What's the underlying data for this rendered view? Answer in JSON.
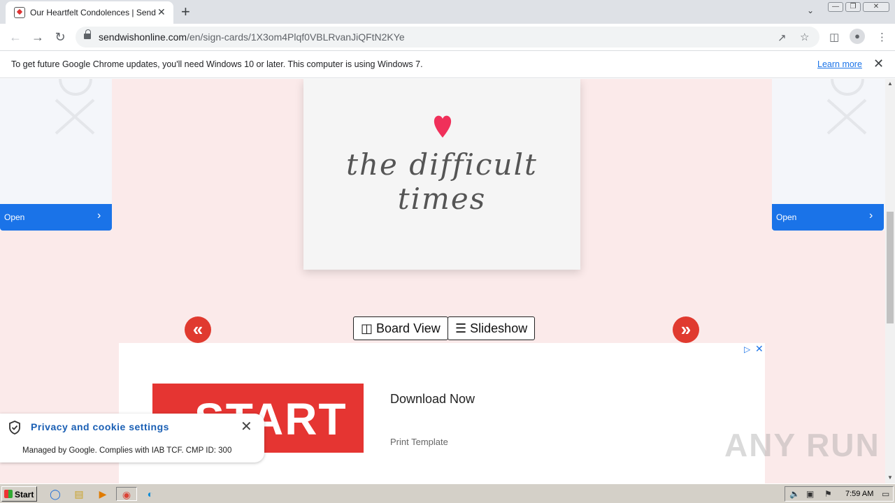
{
  "browser": {
    "tab": {
      "title": "Our Heartfelt Condolences | Sendwish",
      "close": "✕"
    },
    "new_tab": "+",
    "window_buttons": [
      "—",
      "❐",
      "✕"
    ],
    "address": {
      "domain": "sendwishonline.com",
      "path": "/en/sign-cards/1X3om4Plqf0VBLRvanJiQFtN2KYe"
    },
    "infobar": {
      "message": "To get future Google Chrome updates, you'll need Windows 10 or later. This computer is using Windows 7.",
      "learn_more": "Learn more",
      "close": "✕"
    }
  },
  "page": {
    "left_ad": {
      "open_label": "Open"
    },
    "right_ad": {
      "open_label": "Open"
    },
    "card": {
      "text": "the difficult times",
      "heart_color": "#f0305a"
    },
    "controls": {
      "prev": "«",
      "next": "»",
      "board_view": "Board View",
      "slideshow": "Slideshow"
    },
    "banner_ad": {
      "image_text": "START",
      "headline": "Download Now",
      "subtitle": "Print Template"
    },
    "cookie_panel": {
      "title": "Privacy and cookie settings",
      "subtitle": "Managed by Google. Complies with IAB TCF. CMP ID: 300"
    },
    "watermark": "ANY RUN"
  },
  "taskbar": {
    "start_label": "Start",
    "time": "7:59 AM"
  },
  "colors": {
    "page_bg": "#fbeaea",
    "accent_red": "#e03a2f",
    "blue": "#1a73e8"
  }
}
